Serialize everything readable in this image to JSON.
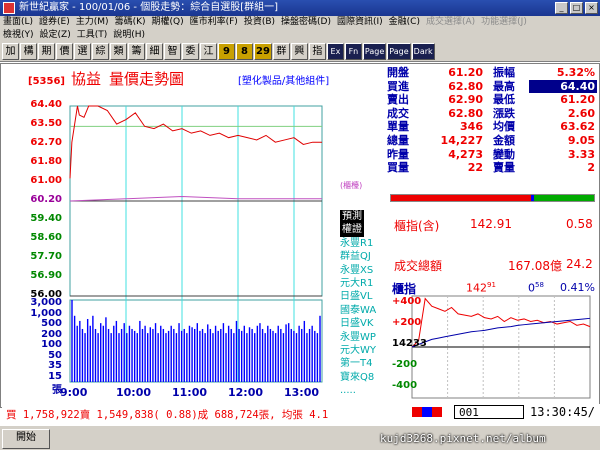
{
  "window": {
    "title": "新世紀贏家 - 100/01/06 - 個股走勢：綜合自選股[群組一]",
    "min": "_",
    "max": "□",
    "close": "×"
  },
  "menu1": [
    "畫面(L)",
    "證券(E)",
    "主力(M)",
    "籌碼(K)",
    "期權(Q)",
    "匯市利率(F)",
    "投資(B)",
    "操盤密碼(D)",
    "國際資訊(I)",
    "金融(C)",
    "成交選擇(A)",
    "功能選擇(J)"
  ],
  "menu2": [
    "檢視(Y)",
    "設定(Z)",
    "工具(T)",
    "說明(H)"
  ],
  "toolbar": [
    "加",
    "構",
    "期",
    "價",
    "選",
    "綜",
    "類",
    "籌",
    "細",
    "智",
    "委",
    "江",
    "9",
    "8",
    "29",
    "群",
    "興",
    "指"
  ],
  "toolbar_dark": [
    "Ex",
    "Fn",
    "Page",
    "Page",
    "Dark"
  ],
  "stock": {
    "code": "[5356]",
    "name": "協益",
    "chart_title": "量價走勢圖",
    "industry": "[塑化製品/其他組件]"
  },
  "price_axis": [
    {
      "v": "64.40",
      "c": "r"
    },
    {
      "v": "63.50",
      "c": "r"
    },
    {
      "v": "62.70",
      "c": "r"
    },
    {
      "v": "61.80",
      "c": "r"
    },
    {
      "v": "61.00",
      "c": "r"
    },
    {
      "v": "60.20",
      "c": "p"
    },
    {
      "v": "59.40",
      "c": "g"
    },
    {
      "v": "58.60",
      "c": "g"
    },
    {
      "v": "57.70",
      "c": "g"
    },
    {
      "v": "56.90",
      "c": "g"
    },
    {
      "v": "56.00",
      "c": "k"
    }
  ],
  "vol_axis": [
    "3,000",
    "1,000",
    "500",
    "200",
    "100",
    "50",
    "35",
    "15",
    "張"
  ],
  "time_axis": [
    "9:00",
    "10:00",
    "11:00",
    "12:00",
    "13:00"
  ],
  "tag_label": "(櫃檯)",
  "brokers": [
    "預測",
    "權證",
    "永豐R1",
    "群益QJ",
    "永豐XS",
    "元大R1",
    "日盛VL",
    "國泰WA",
    "日盛VK",
    "永豐WP",
    "元大WY",
    "第一T4",
    "寶來Q8",
    "....."
  ],
  "quote": [
    {
      "l": "開盤",
      "v": "61.20",
      "l2": "振幅",
      "v2": "5.32%"
    },
    {
      "l": "買進",
      "v": "62.80",
      "l2": "最高",
      "v2": "64.40",
      "box": true
    },
    {
      "l": "賣出",
      "v": "62.90",
      "l2": "最低",
      "v2": "61.20"
    },
    {
      "l": "成交",
      "v": "62.80",
      "l2": "漲跌",
      "v2": "2.60"
    },
    {
      "l": "單量",
      "v": "346",
      "l2": "均價",
      "v2": "63.62"
    },
    {
      "l": "總量",
      "v": "14,227",
      "l2": "金額",
      "v2": "9.05"
    },
    {
      "l": "昨量",
      "v": "4,273",
      "l2": "變動",
      "v2": "3.33"
    },
    {
      "l": "買量",
      "v": "22",
      "l2": "賣量",
      "v2": "2"
    }
  ],
  "taiex": {
    "label": "櫃指(含)",
    "value": "142.91",
    "change": "0.58"
  },
  "turnover": {
    "label": "成交總額",
    "value": "167.08億",
    "change": "24.2"
  },
  "mini": {
    "label": "櫃指",
    "value": "142",
    "value_sup": "91",
    "chg": "0",
    "chg_sup": "58",
    "pct": "0.41%",
    "axis": [
      "+400",
      "+200",
      "14233",
      "-200",
      "-400"
    ]
  },
  "status": {
    "summary": "買 1,758,922賣 1,549,838( 0.88)成 688,724張, 均張 4.1",
    "code": "001",
    "clock": "13:30:45/"
  },
  "taskbar": {
    "start": "開始",
    "watermark": "kujd3268.pixnet.net/album"
  },
  "colors": {
    "up": "#e00000",
    "down": "#008000",
    "axis": "#0000aa",
    "grid": "#40e0e0",
    "price": "#e00000",
    "avg": "#c050c0",
    "volume": "#0000ff"
  },
  "chart_data": [
    {
      "type": "line",
      "title": "量價走勢圖",
      "x_range": [
        "9:00",
        "13:30"
      ],
      "ylim": [
        56.0,
        64.4
      ],
      "reference_line": 60.2,
      "series": [
        {
          "x": [
            "9:00",
            "9:02",
            "9:05",
            "9:08",
            "9:10",
            "9:15",
            "9:20",
            "9:30",
            "9:40",
            "9:50",
            "10:00",
            "10:10",
            "10:20",
            "10:30",
            "10:40",
            "10:50",
            "11:00",
            "11:10",
            "11:20",
            "11:30",
            "11:40",
            "11:50",
            "12:00",
            "12:10",
            "12:20",
            "12:30",
            "12:40",
            "12:50",
            "13:00",
            "13:10",
            "13:20",
            "13:30"
          ],
          "values": [
            61.2,
            62.8,
            63.6,
            64.4,
            64.0,
            63.9,
            64.4,
            64.4,
            64.2,
            63.6,
            63.8,
            64.1,
            63.5,
            63.4,
            63.6,
            63.3,
            63.4,
            63.2,
            63.3,
            63.1,
            63.2,
            63.0,
            63.1,
            63.0,
            62.9,
            63.1,
            62.8,
            62.9,
            63.0,
            62.7,
            62.8,
            62.8
          ]
        },
        {
          "x": [
            "9:00",
            "10:00",
            "11:00",
            "12:00",
            "13:00",
            "13:30"
          ],
          "values": [
            60.2,
            60.3,
            60.4,
            60.3,
            60.3,
            60.3
          ]
        }
      ]
    },
    {
      "type": "bar",
      "title": "",
      "ylabel": "張",
      "ylim": [
        0,
        3000
      ],
      "x_range": [
        "9:00",
        "13:30"
      ],
      "values": [
        3000,
        1000,
        500,
        700,
        400,
        300,
        800,
        500,
        1000,
        400,
        300,
        600,
        500,
        900,
        400,
        300,
        500,
        700,
        300,
        400,
        600,
        300,
        500,
        400,
        350,
        300,
        700,
        400,
        500,
        300,
        450,
        400,
        600,
        300,
        500,
        400,
        300,
        350,
        500,
        400,
        300,
        600,
        350,
        400,
        300,
        500,
        450,
        400,
        600,
        350,
        400,
        300,
        550,
        400,
        300,
        500,
        350,
        400,
        600,
        300,
        500,
        400,
        300,
        700,
        400,
        350,
        500,
        300,
        450,
        400,
        300,
        500,
        600,
        400,
        300,
        500,
        400,
        350,
        300,
        500,
        400,
        300,
        550,
        600,
        400,
        350,
        300,
        500,
        400,
        700,
        300,
        400,
        500,
        350,
        300,
        1000
      ]
    },
    {
      "type": "line",
      "title": "櫃指",
      "ylim": [
        -400,
        400
      ],
      "x_range": [
        "9:00",
        "13:30"
      ],
      "series": [
        {
          "values": [
            0,
            50,
            380,
            320,
            300,
            280,
            310,
            260,
            250,
            240,
            260,
            230,
            220,
            240,
            200,
            230,
            210,
            220,
            200,
            210,
            190,
            200,
            180,
            190,
            200,
            170,
            180,
            160
          ]
        },
        {
          "values": [
            0,
            20,
            40,
            60,
            70,
            80,
            90,
            100,
            110,
            120,
            125,
            130,
            140,
            150,
            155,
            160,
            170,
            175,
            180,
            185,
            190,
            195,
            200,
            205,
            210,
            215,
            220,
            225
          ]
        }
      ]
    }
  ]
}
